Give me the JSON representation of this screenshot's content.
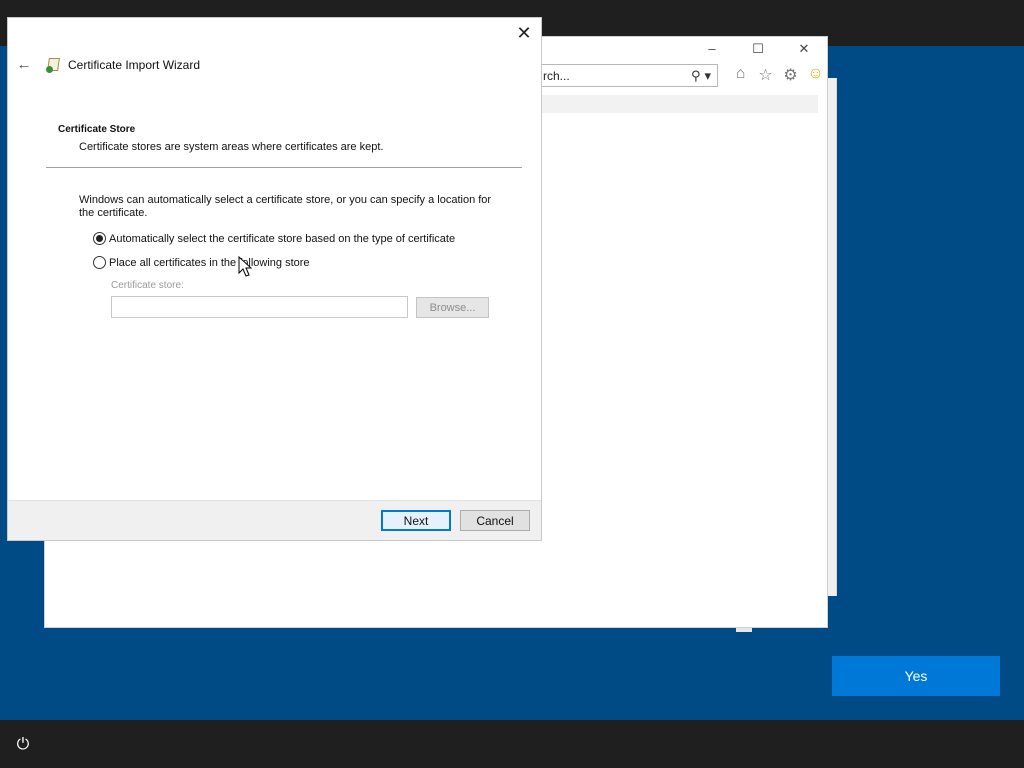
{
  "background": {
    "desktop_color": "#004a85",
    "taskbar_color": "#1f1f1f"
  },
  "browser": {
    "address_text": "rch...",
    "title_controls": [
      "–",
      "☐",
      "✕"
    ],
    "toolbar_icons": [
      "home-icon",
      "star-icon",
      "gear-icon",
      "smiley-icon"
    ]
  },
  "wizard": {
    "title": "Certificate Import Wizard",
    "section_title": "Certificate Store",
    "section_description": "Certificate stores are system areas where certificates are kept.",
    "intro": "Windows can automatically select a certificate store, or you can specify a location for the certificate.",
    "options": [
      {
        "label": "Automatically select the certificate store based on the type of certificate",
        "checked": true
      },
      {
        "label": "Place all certificates in the following store",
        "checked": false
      }
    ],
    "store_label": "Certificate store:",
    "store_value": "",
    "browse_label": "Browse...",
    "next_label": "Next",
    "cancel_label": "Cancel"
  },
  "prompt": {
    "yes_label": "Yes"
  },
  "accent_color": "#0078d7"
}
